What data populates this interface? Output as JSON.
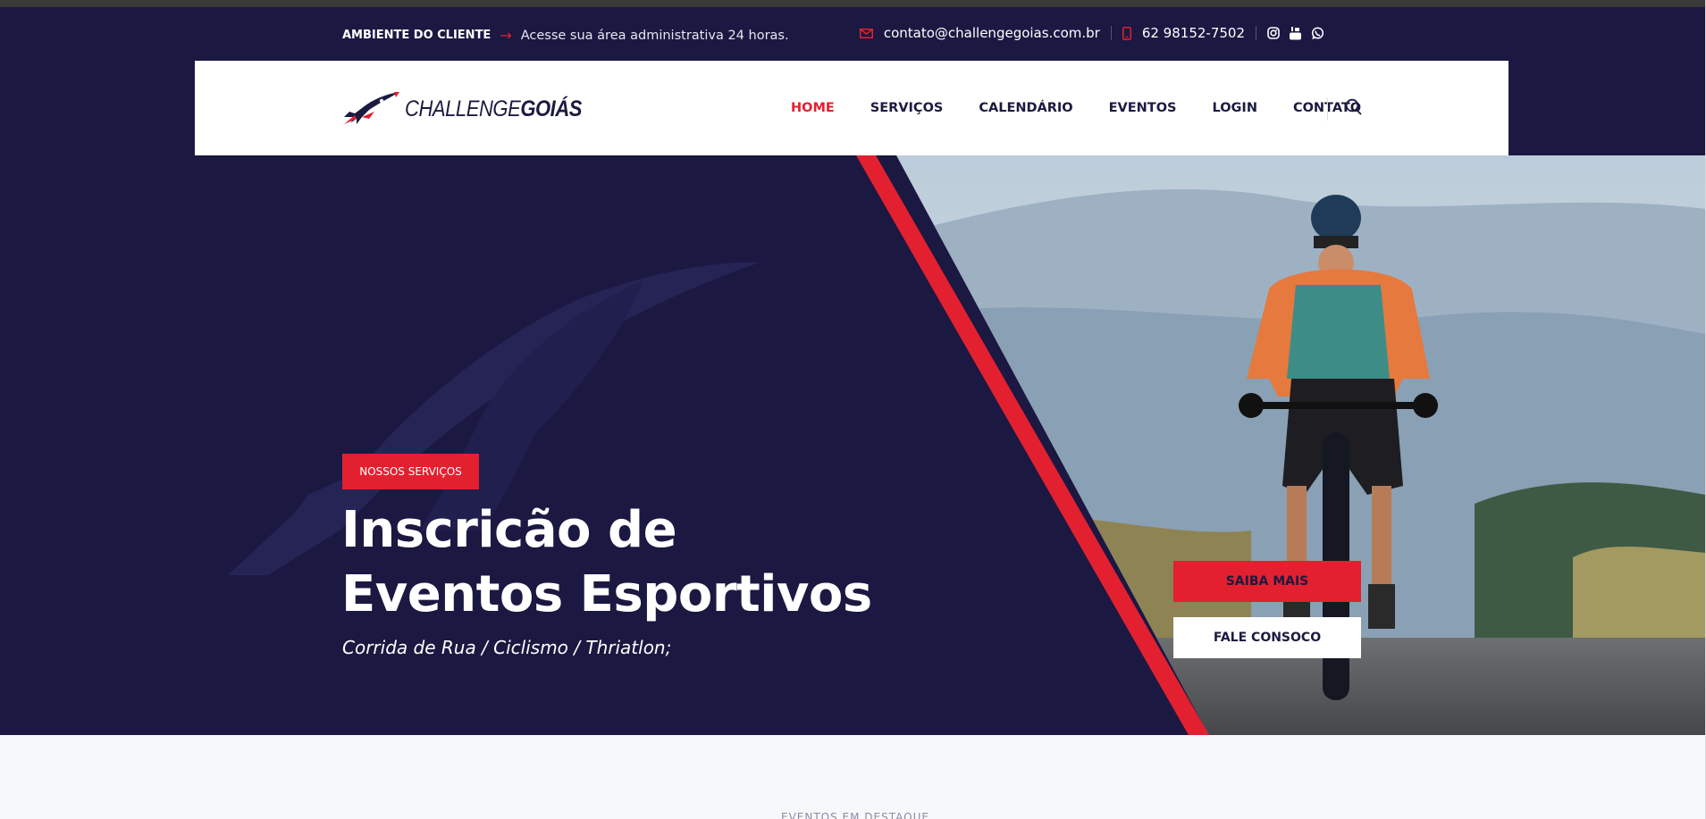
{
  "topbar": {
    "client_label": "AMBIENTE DO CLIENTE",
    "access_text": "Acesse sua área administrativa 24 horas.",
    "email": "contato@challengegoias.com.br",
    "phone": "62 98152-7502",
    "social_icons": [
      "instagram-icon",
      "youtube-icon",
      "whatsapp-icon"
    ]
  },
  "header": {
    "logo": {
      "primary": "CHALLENGE",
      "secondary": "GOIÁS"
    },
    "nav": [
      {
        "label": "HOME",
        "active": true
      },
      {
        "label": "SERVIÇOS",
        "active": false
      },
      {
        "label": "CALENDÁRIO",
        "active": false
      },
      {
        "label": "EVENTOS",
        "active": false
      },
      {
        "label": "LOGIN",
        "active": false
      },
      {
        "label": "CONTATO",
        "active": false
      }
    ]
  },
  "hero": {
    "badge": "NOSSOS SERVIÇOS",
    "title_line1": "Inscricão de",
    "title_line2": "Eventos Esportivos",
    "subtitle": "Corrida de Rua / Ciclismo / Thriatlon;",
    "primary_button": "SAIBA MAIS",
    "secondary_button": "FALE CONSOCO"
  },
  "section": {
    "label": "EVENTOS EM DESTAQUE"
  },
  "colors": {
    "navy": "#1b1842",
    "red": "#e3202f",
    "white": "#ffffff",
    "light_bg": "#f7f8fb"
  }
}
